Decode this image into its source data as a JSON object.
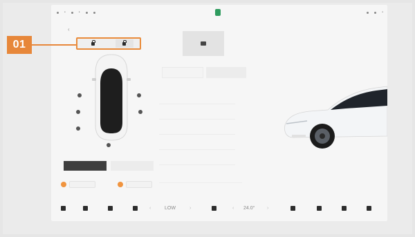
{
  "callout": {
    "number": "01"
  },
  "status_bar": {
    "left_items": [
      "•",
      "•",
      "•",
      "•"
    ],
    "right_items": [
      "•",
      "•",
      "•"
    ]
  },
  "left_panel": {
    "back_glyph": "‹",
    "lock_group": {
      "items": [
        "lock-closed-icon",
        "lock-open-icon"
      ]
    },
    "mode_buttons": [
      "",
      ""
    ],
    "options": [
      "",
      ""
    ]
  },
  "middle_panel": {
    "segment_labels": [
      "",
      ""
    ]
  },
  "dock": {
    "items": [
      {
        "icon": "home-icon"
      },
      {
        "icon": "car-icon"
      },
      {
        "icon": "fan-icon"
      },
      {
        "icon": "seat-icon"
      },
      {
        "text": "LOW"
      },
      {
        "icon": "climate-icon"
      },
      {
        "text": "24.0°"
      },
      {
        "icon": "seat-heat-icon"
      },
      {
        "icon": "music-icon"
      },
      {
        "icon": "apps-icon"
      },
      {
        "icon": "volume-icon"
      }
    ]
  },
  "colors": {
    "accent": "#e7873a",
    "dark": "#2c2c2c"
  }
}
